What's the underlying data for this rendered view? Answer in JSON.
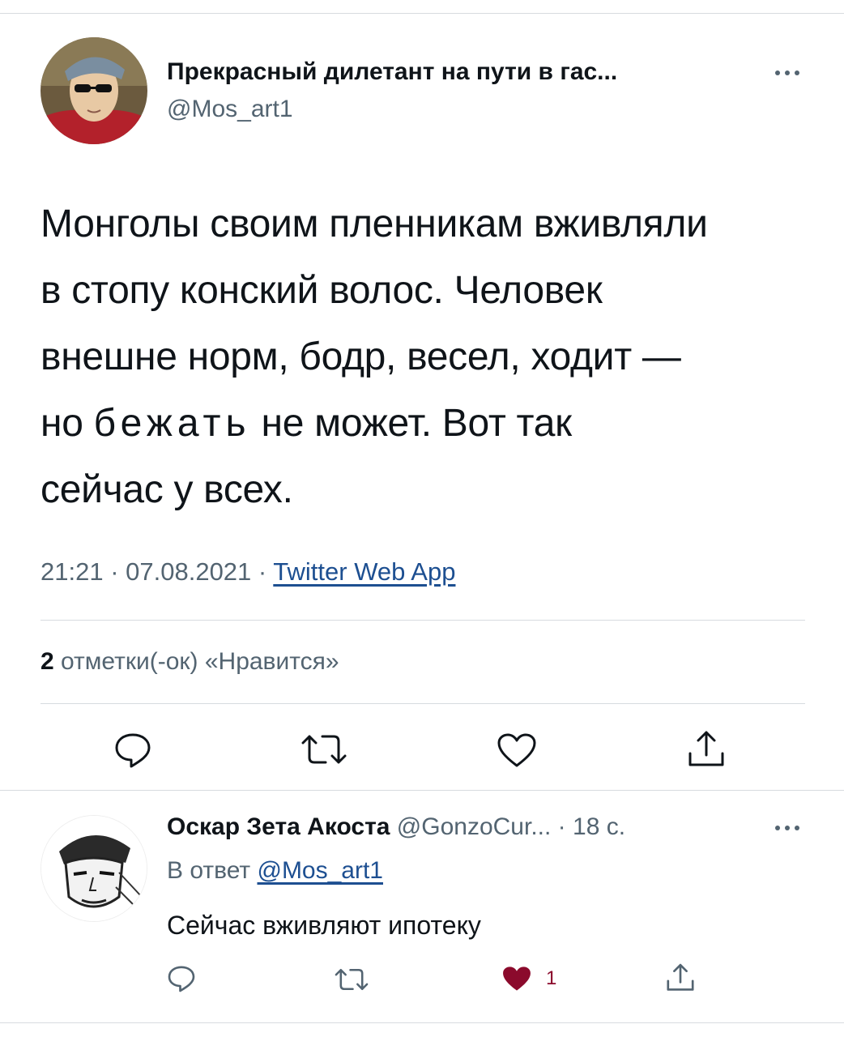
{
  "tweet": {
    "author_name": "Прекрасный дилетант на пути в гас...",
    "author_handle": "@Mos_art1",
    "text_lines": [
      "Монголы своим пленникам вживляли",
      "в стопу конский волос. Человек",
      "внешне норм, бодр, весел, ходит —"
    ],
    "text_line4_a": "но ",
    "text_line4_spaced": "бежать",
    "text_line4_b": " не может. Вот так",
    "text_line5": "сейчас у всех.",
    "time": "21:21",
    "date": "07.08.2021",
    "separator": " · ",
    "source": "Twitter Web App",
    "likes_count": "2",
    "likes_label": " отметки(-ок) «Нравится»"
  },
  "reply": {
    "author_name": "Оскар Зета Акоста",
    "author_handle": "@GonzoCur...",
    "time": " · 18 с.",
    "reply_to_label": "В ответ ",
    "reply_to_handle": "@Mos_art1",
    "text": "Сейчас вживляют ипотеку",
    "like_count": "1"
  },
  "icons": {
    "avatar_main": "avatar",
    "avatar_reply": "avatar",
    "more": "more-icon",
    "reply": "reply-icon",
    "retweet": "retweet-icon",
    "like": "heart-icon",
    "share": "share-icon"
  },
  "colors": {
    "text": "#0f1419",
    "secondary": "#536471",
    "link": "#1d4f91",
    "liked_heart": "#8b0a2c",
    "divider": "#d7dbdf"
  }
}
